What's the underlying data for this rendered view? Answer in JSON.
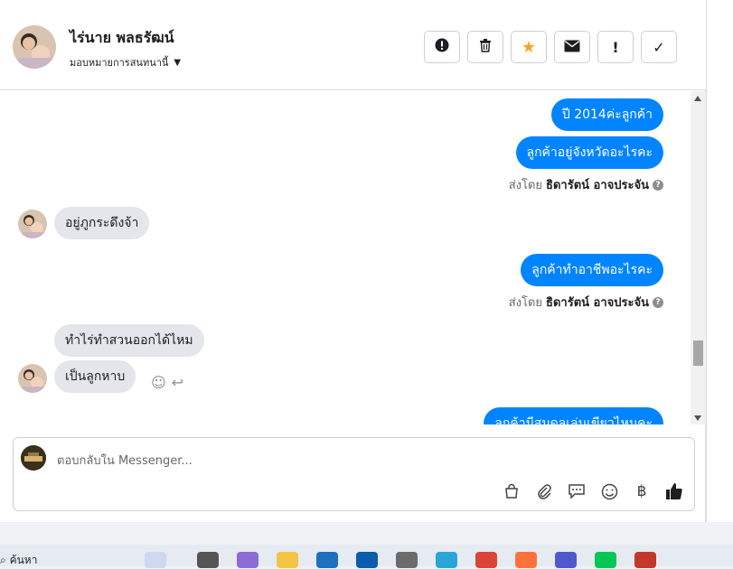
{
  "header": {
    "contact_name": "ไร่นาย พลธรัฒน์",
    "assign_label": "มอบหมายการสนทนานี้",
    "buttons": [
      {
        "name": "spam-button",
        "glyph": "!"
      },
      {
        "name": "delete-button",
        "glyph": "🗑"
      },
      {
        "name": "star-button",
        "glyph": "★"
      },
      {
        "name": "mark-unread-button",
        "glyph": "✉"
      },
      {
        "name": "follow-up-button",
        "glyph": "!"
      },
      {
        "name": "done-button",
        "glyph": "✓"
      }
    ]
  },
  "messages": {
    "out1": "ปี 2014ค่ะลูกค้า",
    "out2": "ลูกค้าอยู่จังหวัดอะไรคะ",
    "sent_by_1_prefix": "ส่งโดย",
    "sent_by_1_name": "ธิดารัตน์ อาจประจัน",
    "in1": "อยู่ภูกระดึงจ้า",
    "out3": "ลูกค้าทำอาชีพอะไรคะ",
    "sent_by_2_prefix": "ส่งโดย",
    "sent_by_2_name": "ธิดารัตน์ อาจประจัน",
    "in2": "ทำไร่ทำสวนออกได้ไหม",
    "in3": "เป็นลูกหาบ",
    "out4_partial": "ลูกค้ามีสมดุลเล่นเขียวไหมคะ"
  },
  "composer": {
    "placeholder": "ตอบกลับใน Messenger...",
    "tools": [
      "bag-icon",
      "paperclip-icon",
      "chat-icon",
      "emoji-icon",
      "baht-icon",
      "like-icon"
    ]
  },
  "taskbar": {
    "search_label": "ค้นหา"
  },
  "colors": {
    "outgoing_bubble": "#0084ff",
    "incoming_bubble": "#e4e6eb",
    "star": "#f5a623"
  }
}
